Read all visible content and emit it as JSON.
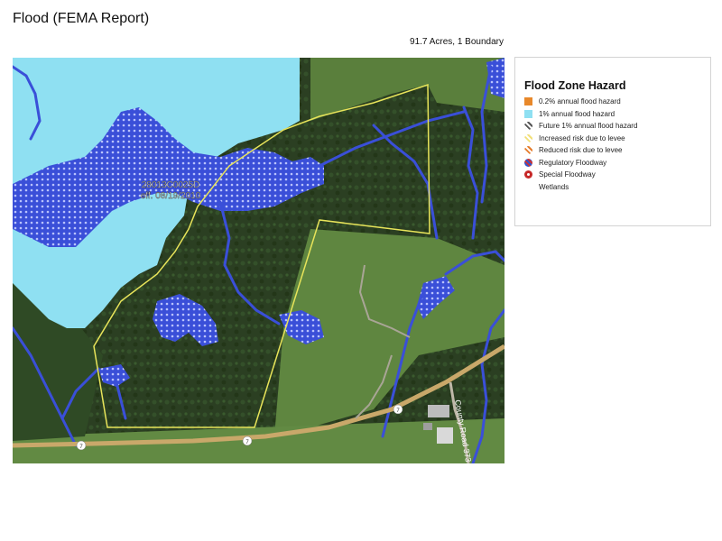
{
  "page": {
    "title": "Flood (FEMA Report)",
    "summary": "91.7 Acres, 1 Boundary"
  },
  "map": {
    "panel_label_line1": "28013C0025D",
    "panel_label_line2": "eff. 08/19/2010",
    "road_shields": [
      "7",
      "7",
      "7"
    ],
    "road_label": "County Road 373",
    "colors": {
      "flood_1pct": "#8fe0f2",
      "floodway_hatch": "#3a4fd8",
      "boundary": "#e8e45a",
      "forest": "#2b3f22",
      "field": "#567a3a",
      "road": "#c9a86a"
    }
  },
  "legend": {
    "title": "Flood Zone Hazard",
    "items": [
      {
        "label": "0.2% annual flood hazard",
        "icon": "orange-square-icon"
      },
      {
        "label": "1% annual flood hazard",
        "icon": "cyan-square-icon"
      },
      {
        "label": "Future 1% annual flood hazard",
        "icon": "gray-hatch-icon"
      },
      {
        "label": "Increased risk due to levee",
        "icon": "yellow-hatch-icon"
      },
      {
        "label": "Reduced risk due to levee",
        "icon": "orange-hatch-icon"
      },
      {
        "label": "Regulatory Floodway",
        "icon": "red-blue-hatch-icon"
      },
      {
        "label": "Special Floodway",
        "icon": "red-dot-icon"
      },
      {
        "label": "Wetlands",
        "icon": "none"
      }
    ]
  }
}
